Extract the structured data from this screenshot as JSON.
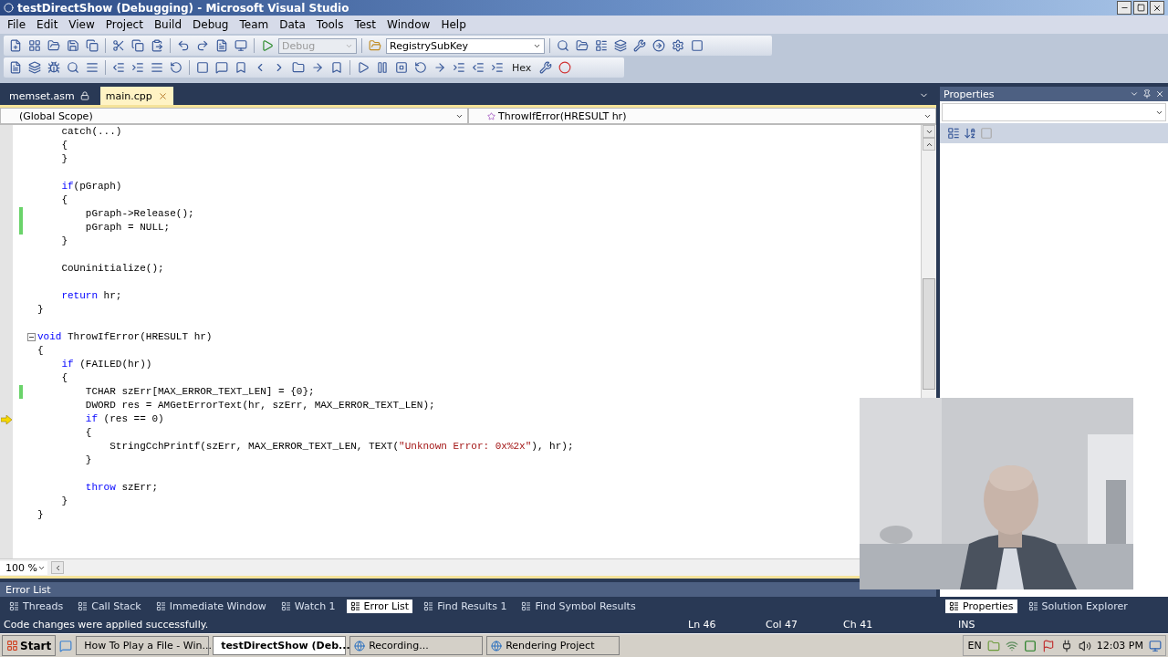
{
  "window": {
    "title": "testDirectShow (Debugging) - Microsoft Visual Studio"
  },
  "menu": [
    "File",
    "Edit",
    "View",
    "Project",
    "Build",
    "Debug",
    "Team",
    "Data",
    "Tools",
    "Test",
    "Window",
    "Help"
  ],
  "toolbar": {
    "configuration": {
      "value": "Debug",
      "disabled": true
    },
    "find_combo": {
      "value": "RegistrySubKey"
    },
    "hex_button": "Hex"
  },
  "document_tabs": [
    {
      "label": "memset.asm",
      "locked": true,
      "selected": false
    },
    {
      "label": "main.cpp",
      "locked": false,
      "selected": true
    }
  ],
  "navigation": {
    "scope": "(Global Scope)",
    "member": "ThrowIfError(HRESULT hr)"
  },
  "code_lines": [
    {
      "kind": "code",
      "segments": [
        {
          "kind": "plain",
          "text": "    catch(...)"
        }
      ],
      "changed": false,
      "current": false,
      "outline_start": false
    },
    {
      "kind": "code",
      "segments": [
        {
          "kind": "plain",
          "text": "    {"
        }
      ],
      "changed": false,
      "current": false,
      "outline_start": false
    },
    {
      "kind": "code",
      "segments": [
        {
          "kind": "plain",
          "text": "    }"
        }
      ],
      "changed": false,
      "current": false,
      "outline_start": false
    },
    {
      "kind": "blank",
      "changed": false,
      "current": false,
      "outline_start": false
    },
    {
      "kind": "code",
      "segments": [
        {
          "kind": "keyword",
          "text": "    if"
        },
        {
          "kind": "plain",
          "text": "(pGraph)"
        }
      ],
      "changed": false,
      "current": false,
      "outline_start": false
    },
    {
      "kind": "code",
      "segments": [
        {
          "kind": "plain",
          "text": "    {"
        }
      ],
      "changed": false,
      "current": false,
      "outline_start": false
    },
    {
      "kind": "code",
      "segments": [
        {
          "kind": "plain",
          "text": "        pGraph->Release();"
        }
      ],
      "changed": true,
      "current": false,
      "outline_start": false
    },
    {
      "kind": "code",
      "segments": [
        {
          "kind": "plain",
          "text": "        pGraph = NULL;"
        }
      ],
      "changed": true,
      "current": false,
      "outline_start": false
    },
    {
      "kind": "code",
      "segments": [
        {
          "kind": "plain",
          "text": "    }"
        }
      ],
      "changed": false,
      "current": false,
      "outline_start": false
    },
    {
      "kind": "blank",
      "changed": false,
      "current": false,
      "outline_start": false
    },
    {
      "kind": "code",
      "segments": [
        {
          "kind": "plain",
          "text": "    CoUninitialize();"
        }
      ],
      "changed": false,
      "current": false,
      "outline_start": false
    },
    {
      "kind": "blank",
      "changed": false,
      "current": false,
      "outline_start": false
    },
    {
      "kind": "code",
      "segments": [
        {
          "kind": "keyword",
          "text": "    return"
        },
        {
          "kind": "plain",
          "text": " hr;"
        }
      ],
      "changed": false,
      "current": false,
      "outline_start": false
    },
    {
      "kind": "code",
      "segments": [
        {
          "kind": "plain",
          "text": "}"
        }
      ],
      "changed": false,
      "current": false,
      "outline_start": false
    },
    {
      "kind": "blank",
      "changed": false,
      "current": false,
      "outline_start": false
    },
    {
      "kind": "code",
      "segments": [
        {
          "kind": "keyword",
          "text": "void"
        },
        {
          "kind": "plain",
          "text": " ThrowIfError(HRESULT hr)"
        }
      ],
      "changed": false,
      "current": false,
      "outline_start": true
    },
    {
      "kind": "code",
      "segments": [
        {
          "kind": "plain",
          "text": "{"
        }
      ],
      "changed": false,
      "current": false,
      "outline_start": false
    },
    {
      "kind": "code",
      "segments": [
        {
          "kind": "keyword",
          "text": "    if"
        },
        {
          "kind": "plain",
          "text": " (FAILED(hr))"
        }
      ],
      "changed": false,
      "current": false,
      "outline_start": false
    },
    {
      "kind": "code",
      "segments": [
        {
          "kind": "plain",
          "text": "    {"
        }
      ],
      "changed": false,
      "current": false,
      "outline_start": false
    },
    {
      "kind": "code",
      "segments": [
        {
          "kind": "plain",
          "text": "        TCHAR szErr[MAX_ERROR_TEXT_LEN] = {0};"
        }
      ],
      "changed": true,
      "current": false,
      "outline_start": false
    },
    {
      "kind": "code",
      "segments": [
        {
          "kind": "plain",
          "text": "        DWORD res = AMGetErrorText(hr, szErr, MAX_ERROR_TEXT_LEN);"
        }
      ],
      "changed": false,
      "current": false,
      "outline_start": false
    },
    {
      "kind": "code",
      "segments": [
        {
          "kind": "keyword",
          "text": "        if"
        },
        {
          "kind": "plain",
          "text": " (res == 0)"
        }
      ],
      "changed": false,
      "current": true,
      "outline_start": false
    },
    {
      "kind": "code",
      "segments": [
        {
          "kind": "plain",
          "text": "        {"
        }
      ],
      "changed": false,
      "current": false,
      "outline_start": false
    },
    {
      "kind": "code",
      "segments": [
        {
          "kind": "plain",
          "text": "            StringCchPrintf(szErr, MAX_ERROR_TEXT_LEN, TEXT("
        },
        {
          "kind": "string",
          "text": "\"Unknown Error: 0x%2x\""
        },
        {
          "kind": "plain",
          "text": "), hr);"
        }
      ],
      "changed": false,
      "current": false,
      "outline_start": false
    },
    {
      "kind": "code",
      "segments": [
        {
          "kind": "plain",
          "text": "        }"
        }
      ],
      "changed": false,
      "current": false,
      "outline_start": false
    },
    {
      "kind": "blank",
      "changed": false,
      "current": false,
      "outline_start": false
    },
    {
      "kind": "code",
      "segments": [
        {
          "kind": "keyword",
          "text": "        throw"
        },
        {
          "kind": "plain",
          "text": " szErr;"
        }
      ],
      "changed": false,
      "current": false,
      "outline_start": false
    },
    {
      "kind": "code",
      "segments": [
        {
          "kind": "plain",
          "text": "    }"
        }
      ],
      "changed": false,
      "current": false,
      "outline_start": false
    },
    {
      "kind": "code",
      "segments": [
        {
          "kind": "plain",
          "text": "}"
        }
      ],
      "changed": false,
      "current": false,
      "outline_start": false
    }
  ],
  "zoom": "100 %",
  "properties": {
    "title": "Properties",
    "tabs": [
      {
        "label": "Properties",
        "selected": true
      },
      {
        "label": "Solution Explorer",
        "selected": false
      }
    ]
  },
  "error_list": {
    "title": "Error List",
    "tabs": [
      {
        "label": "Threads",
        "selected": false
      },
      {
        "label": "Call Stack",
        "selected": false
      },
      {
        "label": "Immediate Window",
        "selected": false
      },
      {
        "label": "Watch 1",
        "selected": false
      },
      {
        "label": "Error List",
        "selected": true
      },
      {
        "label": "Find Results 1",
        "selected": false
      },
      {
        "label": "Find Symbol Results",
        "selected": false
      }
    ]
  },
  "status_bar": {
    "message": "Code changes were applied successfully.",
    "line": "Ln 46",
    "column": "Col 47",
    "char": "Ch 41",
    "mode": "INS"
  },
  "taskbar": {
    "start": "Start",
    "items": [
      {
        "label": "How To Play a File - Win...",
        "selected": false
      },
      {
        "label": "testDirectShow (Deb...",
        "selected": true
      },
      {
        "label": "Recording...",
        "selected": false
      },
      {
        "label": "Rendering Project",
        "selected": false
      }
    ],
    "language": "EN",
    "clock": "12:03 PM"
  }
}
